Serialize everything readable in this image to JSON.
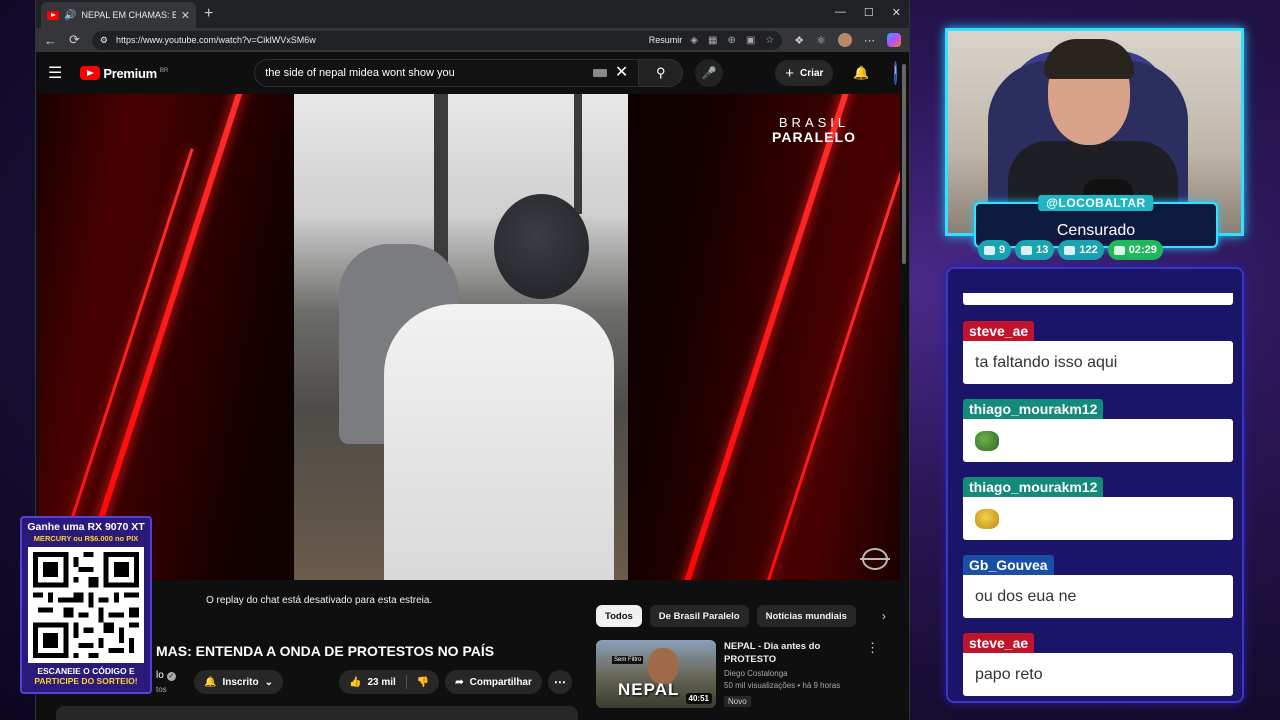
{
  "browser": {
    "tab_title": "NEPAL EM CHAMAS: ENTEND",
    "url": "https://www.youtube.com/watch?v=CiklWVxSM6w",
    "resumir_label": "Resumir"
  },
  "youtube": {
    "logo_text": "Premium",
    "logo_region": "BR",
    "search_query": "the side of nepal midea wont show you",
    "create_label": "Criar",
    "player": {
      "brand_line1": "BRASIL",
      "brand_line2": "PARALELO"
    },
    "chat_notice": "O replay do chat está desativado para esta estreia.",
    "video_title": "MAS: ENTENDA A ONDA DE PROTESTOS NO PAÍS",
    "channel_name": "lo",
    "channel_sub": "tos",
    "subscribed_label": "Inscrito",
    "likes": "23 mil",
    "share_label": "Compartilhar",
    "chips": [
      {
        "label": "Todos",
        "active": true
      },
      {
        "label": "De Brasil Paralelo",
        "active": false
      },
      {
        "label": "Notícias mundiais",
        "active": false
      }
    ],
    "recommendation": {
      "thumb_tag": "Sem Filtro",
      "thumb_word": "NEPAL",
      "duration": "40:51",
      "title": "NEPAL - Dia antes do PROTESTO",
      "channel": "Diego Costalonga",
      "meta": "50 mil visualizações • há 9 horas",
      "badge": "Novo"
    }
  },
  "promo": {
    "line1": "Ganhe uma RX 9070 XT",
    "line2": "MERCURY ou R$6.000 no PIX",
    "line3": "ESCANEIE O CÓDIGO E",
    "line4": "PARTICIPE DO SORTEIO!"
  },
  "stream": {
    "handle": "@LOCOBALTAR",
    "status": "Censurado",
    "stats": [
      {
        "icon": "chat-icon",
        "value": "9"
      },
      {
        "icon": "youtube-icon",
        "value": "13"
      },
      {
        "icon": "viewers-icon",
        "value": "122"
      },
      {
        "icon": "clock-icon",
        "value": "02:29"
      }
    ]
  },
  "chat": {
    "messages": [
      {
        "user": "steve_ae",
        "text": "ta faltando isso aqui",
        "color": "#c0142c"
      },
      {
        "user": "thiago_mourakm12",
        "text": "",
        "emote": "pepe-emote",
        "color": "#138a7a"
      },
      {
        "user": "thiago_mourakm12",
        "text": "",
        "emote": "yellow-emote",
        "color": "#138a7a"
      },
      {
        "user": "Gb_Gouvea",
        "text": "ou dos eua ne",
        "color": "#1a4fa8"
      },
      {
        "user": "steve_ae",
        "text": "papo reto",
        "color": "#c0142c"
      }
    ]
  }
}
